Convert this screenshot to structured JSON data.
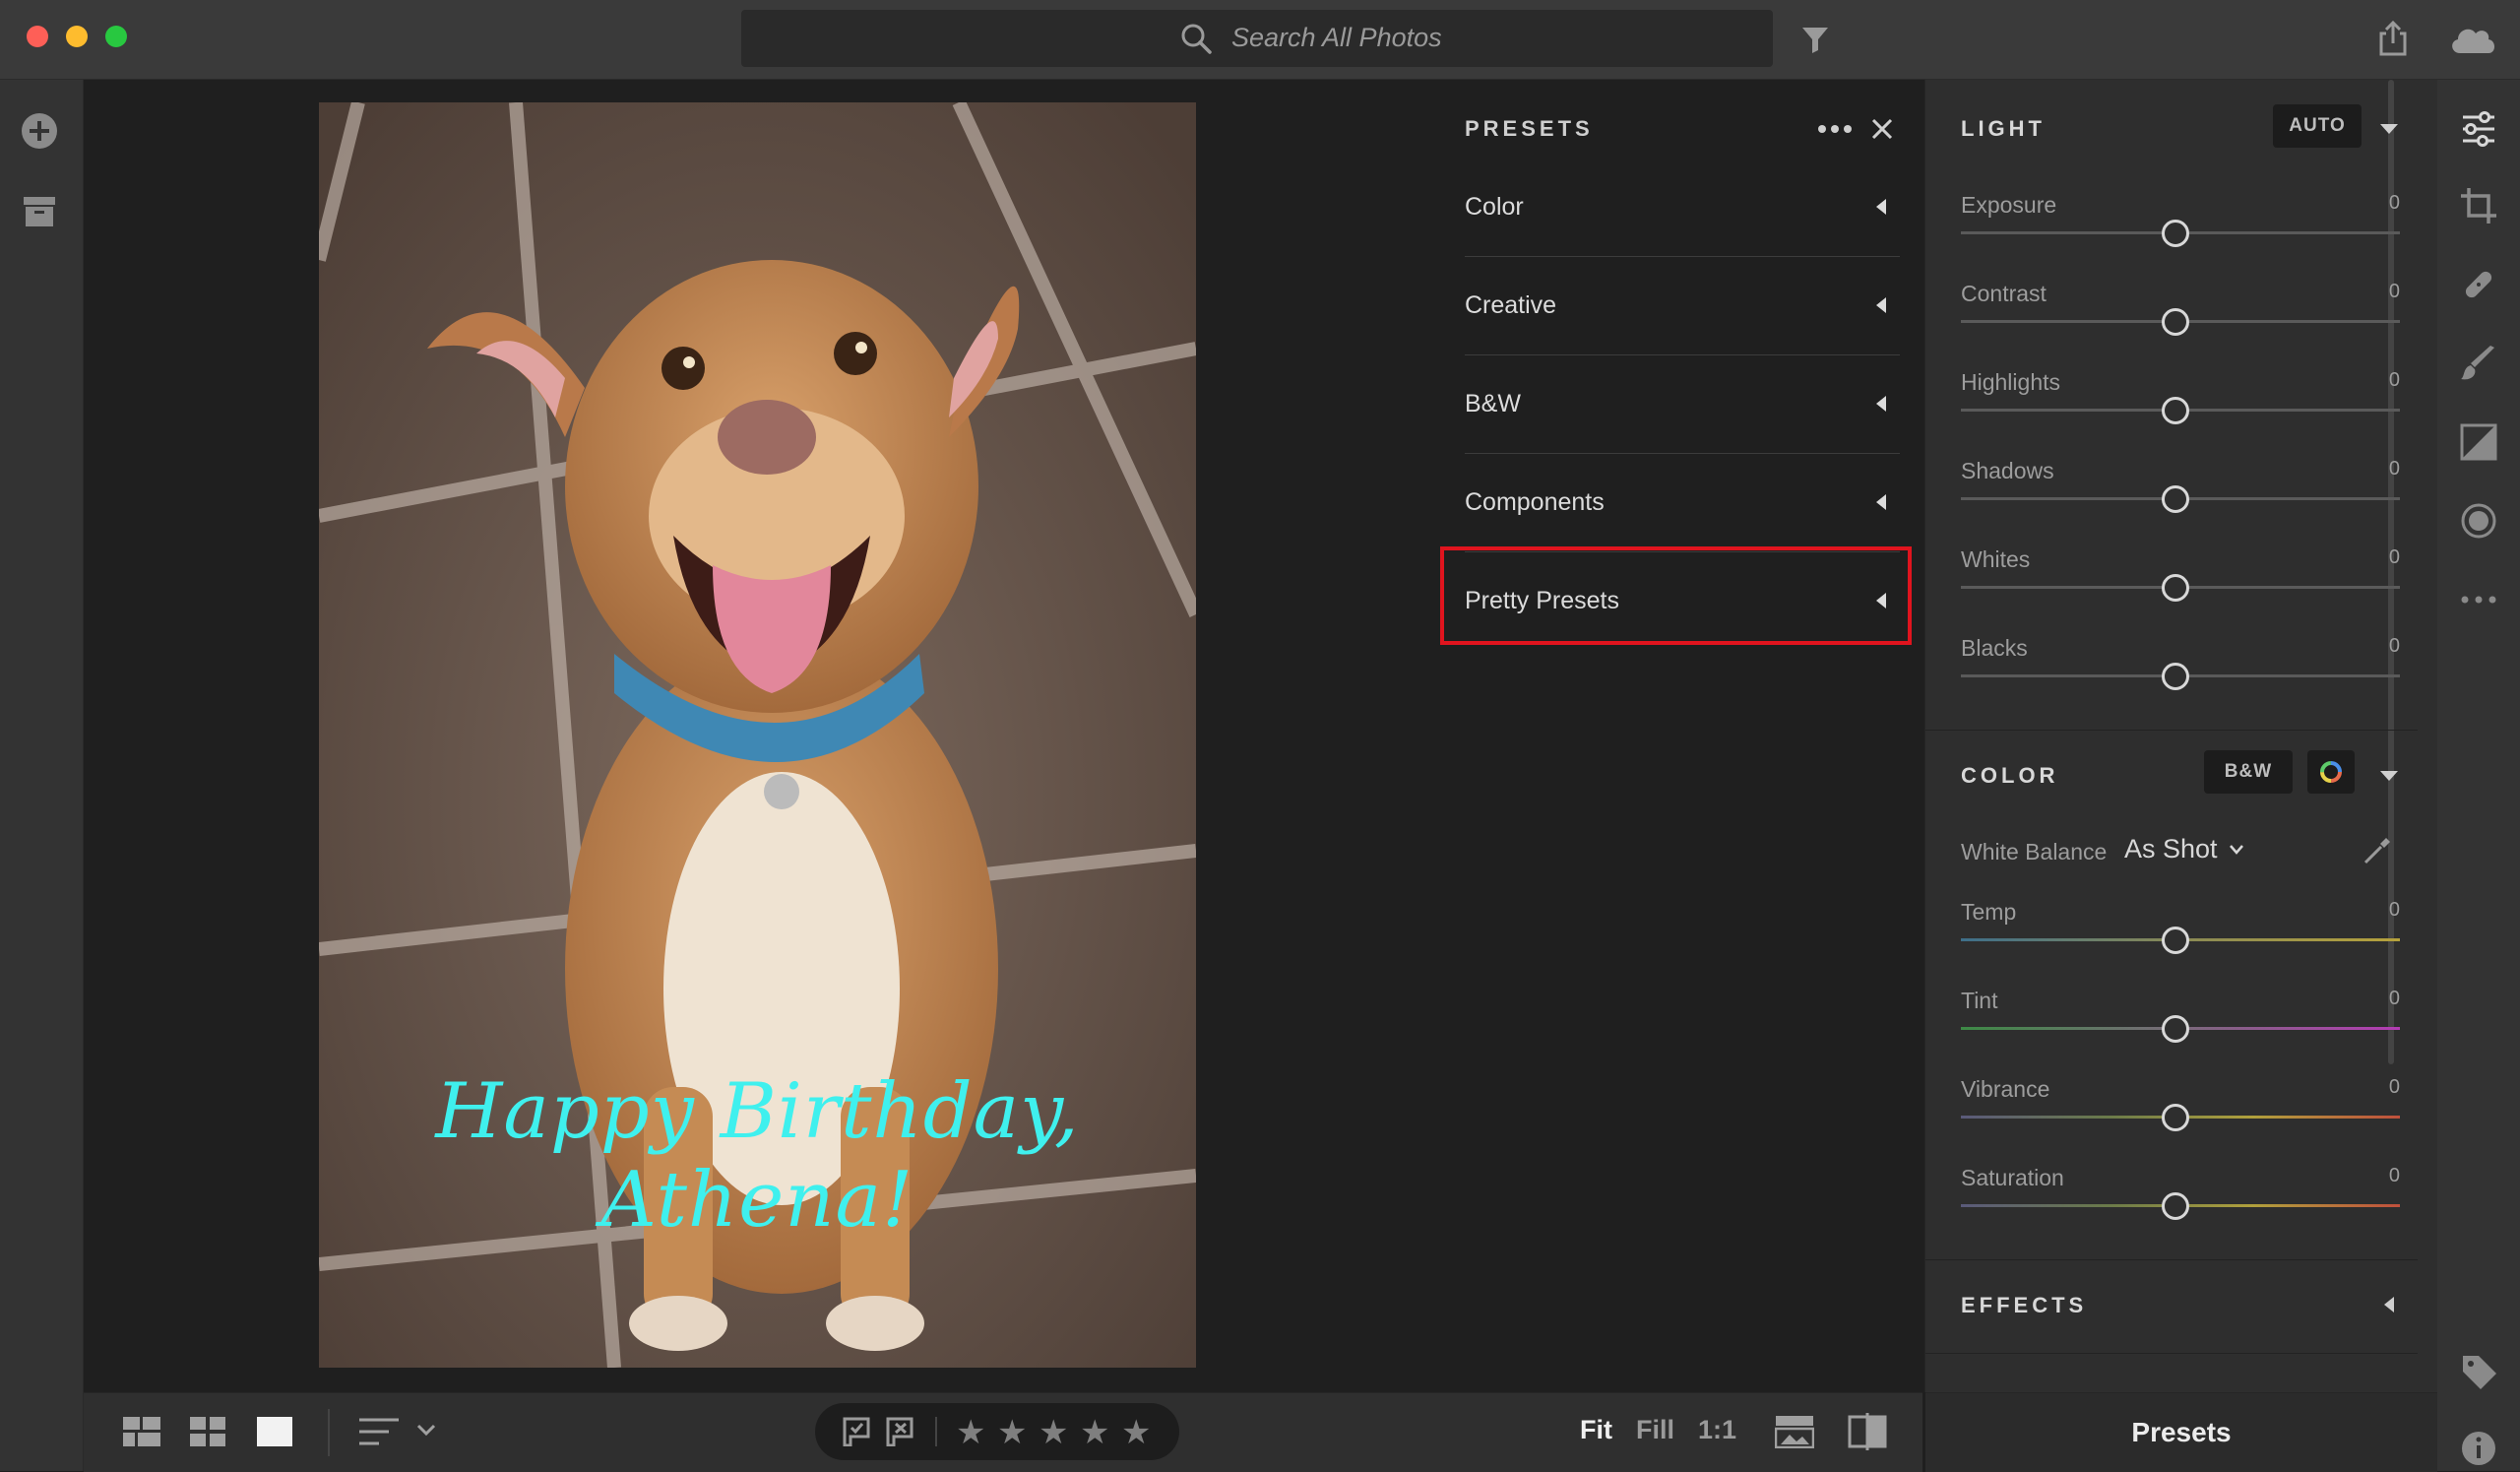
{
  "search": {
    "placeholder": "Search All Photos"
  },
  "photo": {
    "caption": "Happy Birthday, Athena!"
  },
  "presets_panel": {
    "title": "PRESETS",
    "items": [
      {
        "label": "Color"
      },
      {
        "label": "Creative"
      },
      {
        "label": "B&W"
      },
      {
        "label": "Components"
      },
      {
        "label": "Pretty Presets"
      }
    ],
    "highlighted_item": "Pretty Presets"
  },
  "light": {
    "title": "LIGHT",
    "auto_label": "AUTO",
    "sliders": [
      {
        "label": "Exposure",
        "value": "0"
      },
      {
        "label": "Contrast",
        "value": "0"
      },
      {
        "label": "Highlights",
        "value": "0"
      },
      {
        "label": "Shadows",
        "value": "0"
      },
      {
        "label": "Whites",
        "value": "0"
      },
      {
        "label": "Blacks",
        "value": "0"
      }
    ]
  },
  "color": {
    "title": "COLOR",
    "bw_label": "B&W",
    "white_balance_label": "White Balance",
    "white_balance_value": "As Shot",
    "sliders": [
      {
        "label": "Temp",
        "value": "0"
      },
      {
        "label": "Tint",
        "value": "0"
      },
      {
        "label": "Vibrance",
        "value": "0"
      },
      {
        "label": "Saturation",
        "value": "0"
      }
    ]
  },
  "effects": {
    "title": "EFFECTS"
  },
  "bottom": {
    "view_fit": "Fit",
    "view_fill": "Fill",
    "view_1to1": "1:1",
    "presets_button": "Presets"
  },
  "colors": {
    "highlight": "#e0141e",
    "caption": "#3ff0ee",
    "background": "#1f1f1f",
    "panel": "#2e2e2e"
  }
}
